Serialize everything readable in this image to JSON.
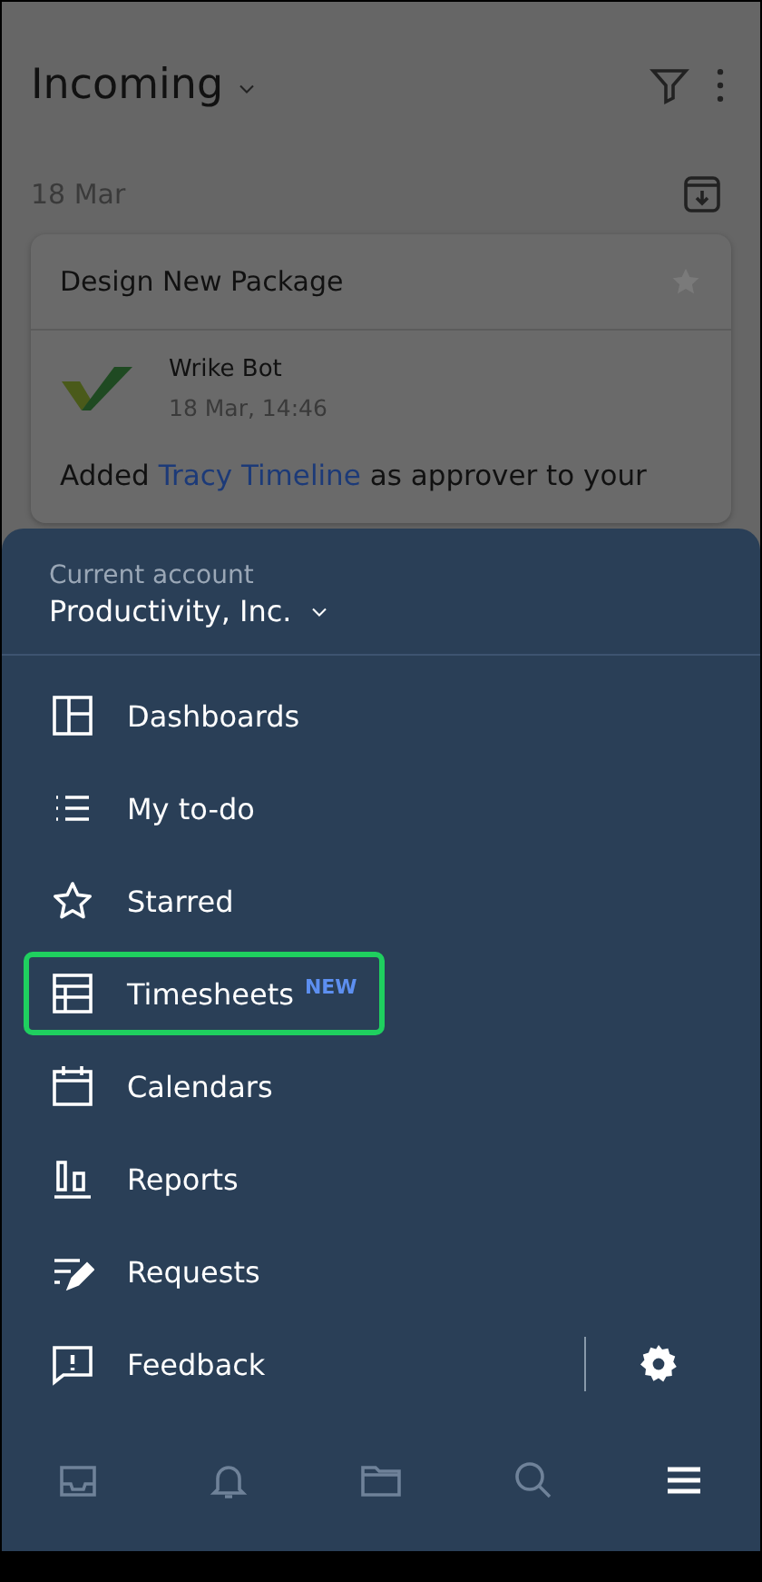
{
  "header": {
    "title": "Incoming"
  },
  "date_group": {
    "label": "18 Mar"
  },
  "card": {
    "title": "Design New Package",
    "starred": false,
    "author": "Wrike Bot",
    "time": "18 Mar, 14:46",
    "message": {
      "before": "Added",
      "link": "Tracy Timeline",
      "after": "as approver to your"
    }
  },
  "account": {
    "caption": "Current account",
    "name": "Productivity, Inc."
  },
  "menu": [
    {
      "kind": "dashboards",
      "label": "Dashboards",
      "highlighted": false
    },
    {
      "kind": "todo",
      "label": "My to-do",
      "highlighted": false
    },
    {
      "kind": "starred",
      "label": "Starred",
      "highlighted": false
    },
    {
      "kind": "timesheets",
      "label": "Timesheets",
      "badge": "NEW",
      "highlighted": true
    },
    {
      "kind": "calendars",
      "label": "Calendars",
      "highlighted": false
    },
    {
      "kind": "reports",
      "label": "Reports",
      "highlighted": false
    },
    {
      "kind": "requests",
      "label": "Requests",
      "highlighted": false
    }
  ],
  "feedback": {
    "label": "Feedback"
  },
  "nav": [
    {
      "kind": "inbox",
      "selected": false
    },
    {
      "kind": "notifications",
      "selected": false
    },
    {
      "kind": "folders",
      "selected": false
    },
    {
      "kind": "search",
      "selected": false
    },
    {
      "kind": "menu",
      "selected": true
    }
  ]
}
